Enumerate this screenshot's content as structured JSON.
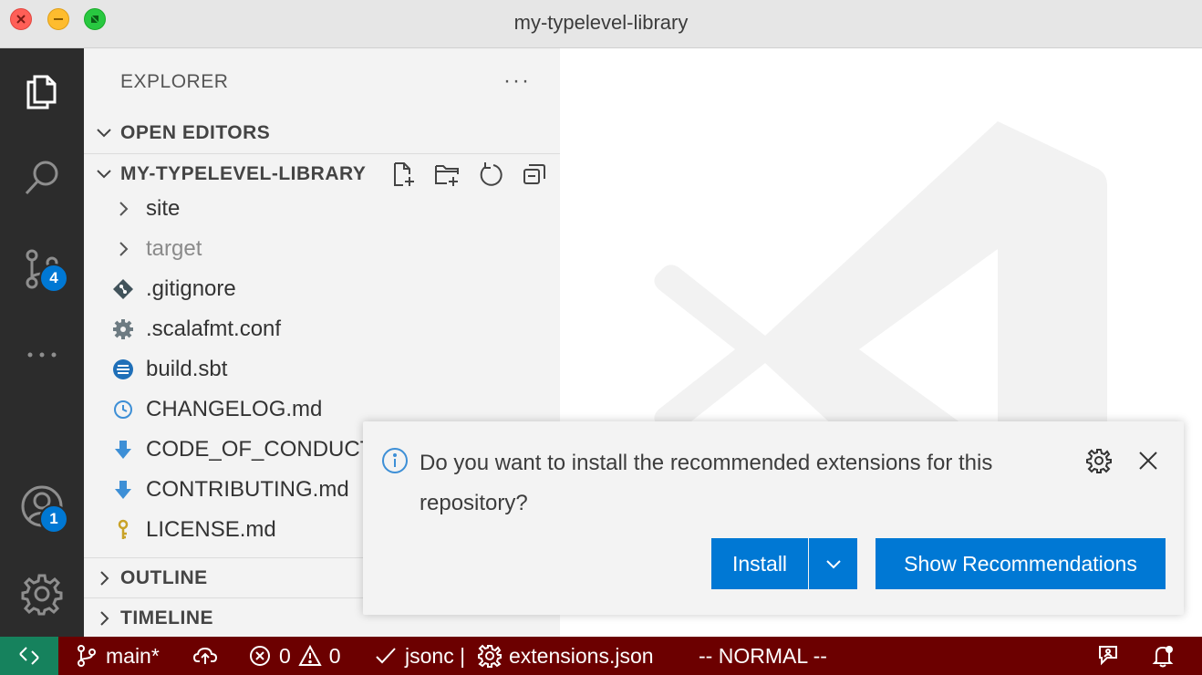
{
  "window": {
    "title": "my-typelevel-library"
  },
  "activity_bar": {
    "items": [
      {
        "name": "Explorer",
        "icon": "files-icon"
      },
      {
        "name": "Search",
        "icon": "search-icon"
      },
      {
        "name": "Source Control",
        "icon": "source-control-icon",
        "badge": "4"
      },
      {
        "name": "More",
        "icon": "ellipsis-icon"
      }
    ],
    "accounts": {
      "icon": "account-icon",
      "badge": "1"
    },
    "settings": {
      "icon": "gear-icon"
    }
  },
  "sidebar": {
    "header": "EXPLORER",
    "more": "···",
    "sections": {
      "open_editors": "OPEN EDITORS",
      "folder": "MY-TYPELEVEL-LIBRARY",
      "outline": "OUTLINE",
      "timeline": "TIMELINE"
    },
    "tree": [
      {
        "label": "site",
        "type": "folder"
      },
      {
        "label": "target",
        "type": "folder"
      },
      {
        "label": ".gitignore",
        "type": "file"
      },
      {
        "label": ".scalafmt.conf",
        "type": "file"
      },
      {
        "label": "build.sbt",
        "type": "file"
      },
      {
        "label": "CHANGELOG.md",
        "type": "file"
      },
      {
        "label": "CODE_OF_CONDUCT.md",
        "type": "file"
      },
      {
        "label": "CONTRIBUTING.md",
        "type": "file"
      },
      {
        "label": "LICENSE.md",
        "type": "file"
      }
    ]
  },
  "notification": {
    "message": "Do you want to install the recommended extensions for this repository?",
    "install_label": "Install",
    "show_recommendations_label": "Show Recommendations"
  },
  "statusbar": {
    "branch": "main*",
    "errors": "0",
    "warnings": "0",
    "language": "jsonc |",
    "file": "extensions.json",
    "mode": "-- NORMAL --"
  },
  "colors": {
    "accent": "#0078d4",
    "statusbar": "#6c0000",
    "remote": "#16825d",
    "activitybar": "#2c2c2c",
    "sidebar": "#f3f3f3"
  }
}
